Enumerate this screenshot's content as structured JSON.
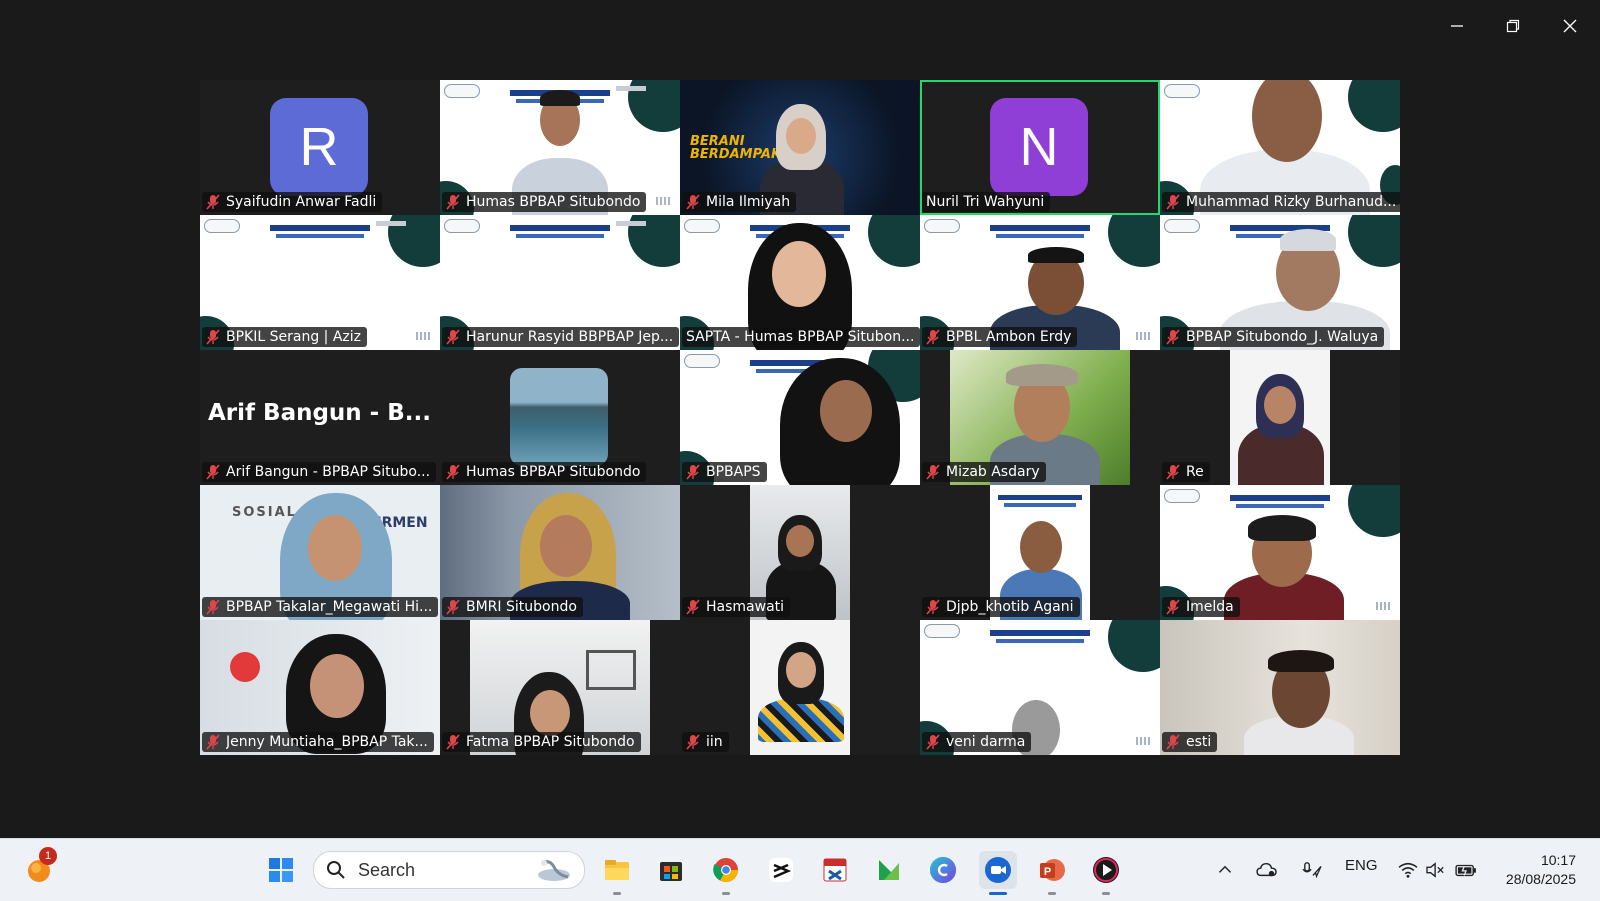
{
  "colors": {
    "active_speaker": "#23d96e",
    "taskbar": "#eef1f6",
    "avatar_r": "#5c6bd6",
    "avatar_n": "#8f3fd6",
    "muted": "#e0454b"
  },
  "window_controls": [
    "minimize-icon",
    "restore-icon",
    "close-icon"
  ],
  "participants": [
    {
      "name": "Syaifudin Anwar Fadli",
      "avatar": "R"
    },
    {
      "name": "Humas BPBAP Situbondo"
    },
    {
      "name": "Mila Ilmiyah",
      "banner_text": "BERANI BERDAMPAK"
    },
    {
      "name": "Nuril Tri Wahyuni",
      "avatar": "N"
    },
    {
      "name": "Muhammad Rizky Burhanud..."
    },
    {
      "name": "BPKIL Serang | Aziz"
    },
    {
      "name": "Harunur Rasyid BBPBAP Jep..."
    },
    {
      "name": "SAPTA - Humas BPBAP Situbon..."
    },
    {
      "name": "BPBL Ambon Erdy"
    },
    {
      "name": "BPBAP Situbondo_J. Waluya"
    },
    {
      "name": "Arif Bangun - BPBAP Situbo...",
      "big_name": "Arif Bangun - B..."
    },
    {
      "name": "Humas BPBAP Situbondo"
    },
    {
      "name": "BPBAPS"
    },
    {
      "name": "Mizab Asdary"
    },
    {
      "name": "Re"
    },
    {
      "name": "BPBAP Takalar_Megawati Hi...",
      "slide_text": "SOSIAL",
      "slide_text2": "ERMEN"
    },
    {
      "name": "BMRI Situbondo"
    },
    {
      "name": "Hasmawati"
    },
    {
      "name": "Djpb_khotib Agani"
    },
    {
      "name": "Imelda"
    },
    {
      "name": "Jenny Muntiaha_BPBAP Tak..."
    },
    {
      "name": "Fatma BPBAP Situbondo"
    },
    {
      "name": "iin"
    },
    {
      "name": "veni darma"
    },
    {
      "name": "esti"
    }
  ],
  "taskbar": {
    "notification_count": "1",
    "search_placeholder": "Search",
    "apps": [
      "windows-start-icon",
      "file-explorer-icon",
      "microsoft-store-icon",
      "chrome-icon",
      "capcut-icon",
      "pdf-tool-icon",
      "libreoffice-icon",
      "canva-icon",
      "zoom-icon",
      "powerpoint-icon",
      "media-player-icon"
    ],
    "language": "ENG",
    "time": "10:17",
    "date": "28/08/2025"
  }
}
